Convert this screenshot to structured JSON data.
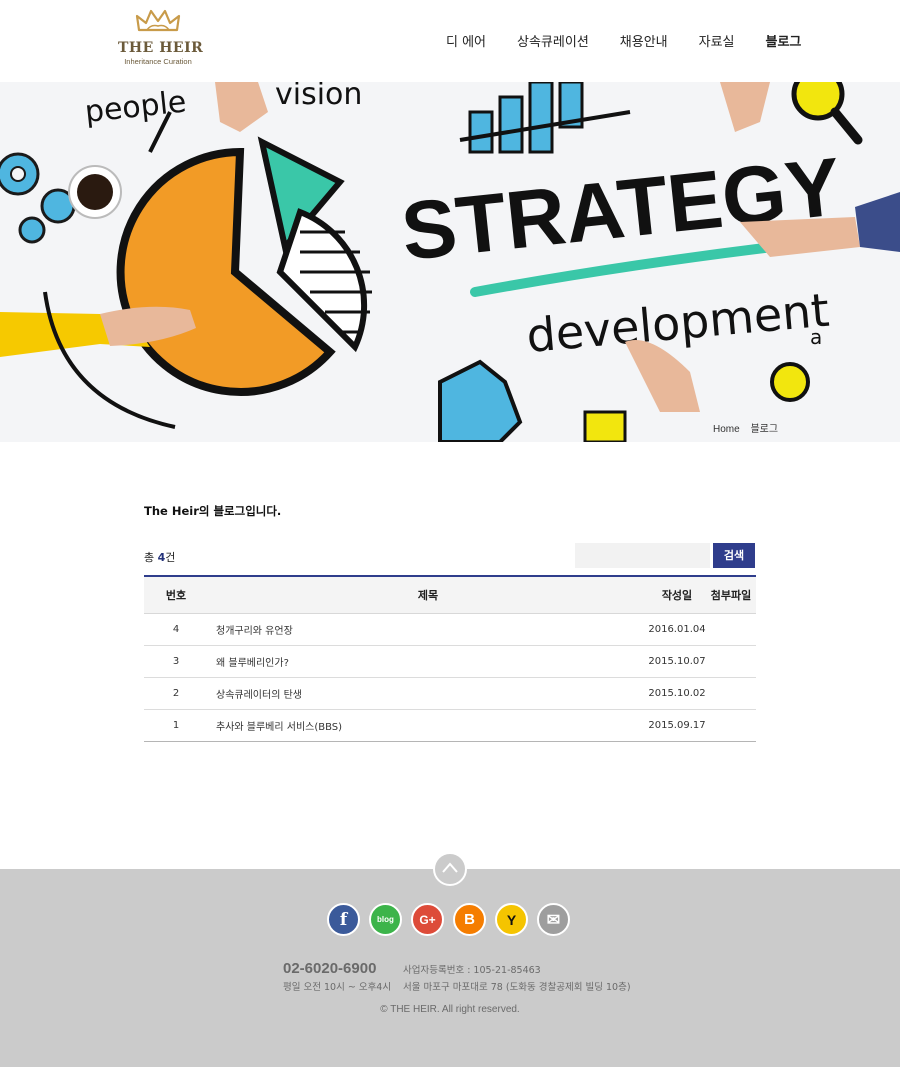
{
  "brand": {
    "name": "THE HEIR",
    "tagline": "Inheritance Curation"
  },
  "nav": {
    "items": [
      {
        "label": "디 에어",
        "active": false
      },
      {
        "label": "상속큐레이션",
        "active": false
      },
      {
        "label": "채용안내",
        "active": false
      },
      {
        "label": "자료실",
        "active": false
      },
      {
        "label": "블로그",
        "active": true
      }
    ]
  },
  "hero": {
    "words": {
      "people": "people",
      "vision": "vision",
      "strategy": "STRATEGY",
      "development": "development",
      "a": "a"
    },
    "breadcrumb": [
      "Home",
      "블로그"
    ]
  },
  "content": {
    "intro": "The Heir의 블로그입니다.",
    "count_prefix": "총 ",
    "count_value": "4",
    "count_suffix": "건",
    "search_placeholder": "",
    "search_button": "검색"
  },
  "board": {
    "columns": [
      "번호",
      "제목",
      "작성일",
      "첨부파일"
    ],
    "rows": [
      {
        "no": "4",
        "title": "청개구리와 유언장",
        "date": "2016.01.04",
        "file": ""
      },
      {
        "no": "3",
        "title": "왜 블루베리인가?",
        "date": "2015.10.07",
        "file": ""
      },
      {
        "no": "2",
        "title": "상속큐레이터의 탄생",
        "date": "2015.10.02",
        "file": ""
      },
      {
        "no": "1",
        "title": "추사와 블루베리 서비스(BBS)",
        "date": "2015.09.17",
        "file": ""
      }
    ]
  },
  "footer": {
    "socials": [
      {
        "name": "facebook-icon",
        "glyph": "f",
        "color": "#3b5a9a"
      },
      {
        "name": "naver-blog-icon",
        "glyph": "blog",
        "color": "#3cb44a"
      },
      {
        "name": "google-plus-icon",
        "glyph": "G+",
        "color": "#dd4b39"
      },
      {
        "name": "blogger-icon",
        "glyph": "B",
        "color": "#f57d00"
      },
      {
        "name": "yellow-id-icon",
        "glyph": "Y",
        "color": "#f5c400"
      },
      {
        "name": "email-icon",
        "glyph": "✉",
        "color": "#9e9e9e"
      }
    ],
    "phone": "02-6020-6900",
    "hours": "평일 오전 10시 ~ 오후4시",
    "business_no": "사업자등록번호 : 105-21-85463",
    "address": "서울 마포구 마포대로 78 (도화동 경찰공제회 빌딩 10층)",
    "copyright": "© THE HEIR. All right reserved."
  },
  "colors": {
    "accent": "#2f3d8c",
    "logo_gold": "#c89b4a",
    "footer_bg": "#cbcbcb"
  }
}
